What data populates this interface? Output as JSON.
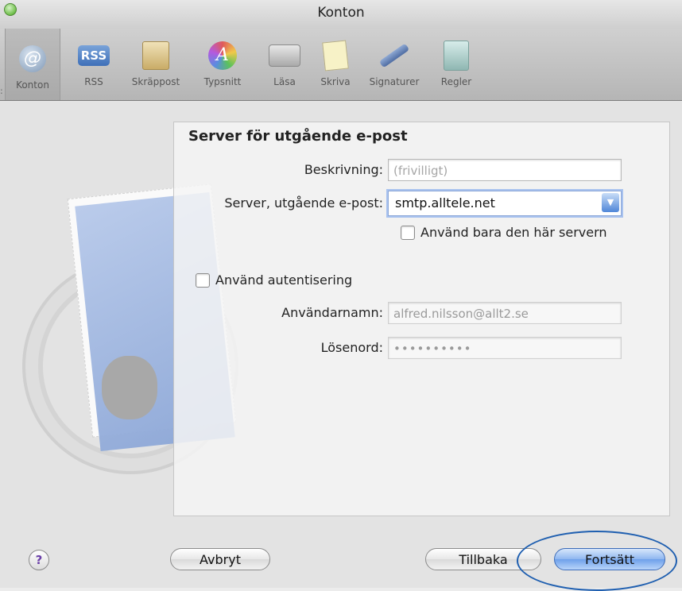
{
  "window": {
    "title": "Konton"
  },
  "toolbar": {
    "items": [
      {
        "label": "Konton",
        "icon": "at-icon"
      },
      {
        "label": "RSS",
        "icon": "rss-icon",
        "badge": "RSS"
      },
      {
        "label": "Skräppost",
        "icon": "junk-mail-icon"
      },
      {
        "label": "Typsnitt",
        "icon": "fonts-icon",
        "glyph": "A"
      },
      {
        "label": "Läsa",
        "icon": "viewing-icon"
      },
      {
        "label": "Skriva",
        "icon": "composing-icon"
      },
      {
        "label": "Signaturer",
        "icon": "signatures-icon"
      },
      {
        "label": "Regler",
        "icon": "rules-icon"
      }
    ]
  },
  "form": {
    "heading": "Server för utgående e-post",
    "description_label": "Beskrivning:",
    "description_placeholder": "(frivilligt)",
    "server_label": "Server, utgående e-post:",
    "server_value": "smtp.alltele.net",
    "only_this_server_label": "Använd bara den här servern",
    "use_auth_label": "Använd autentisering",
    "username_label": "Användarnamn:",
    "username_value": "alfred.nilsson@allt2.se",
    "password_label": "Lösenord:",
    "password_value": "••••••••••"
  },
  "buttons": {
    "help": "?",
    "cancel": "Avbryt",
    "back": "Tillbaka",
    "continue": "Fortsätt"
  },
  "colors": {
    "accent": "#6ea0ea",
    "highlight_ring": "#1f5fb0"
  }
}
